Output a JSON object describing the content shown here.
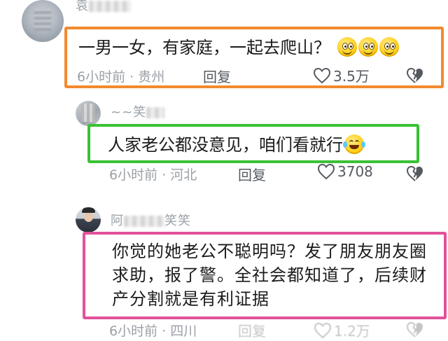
{
  "comments": [
    {
      "username": "袁",
      "text": "一男一女，有家庭，一起去爬山？",
      "emoji_count": 3,
      "time": "6小时前",
      "location": "贵州",
      "reply_label": "回复",
      "likes": "3.5万",
      "highlight_color": "#f28a2e"
    },
    {
      "username": "~~笑",
      "text": "人家老公都没意见，咱们看就行",
      "time": "6小时前",
      "location": "河北",
      "reply_label": "回复",
      "likes": "3708",
      "highlight_color": "#39c234"
    },
    {
      "username": "阿",
      "username_suffix": "笑笑",
      "text": "你觉的她老公不聪明吗？发了朋友朋友圈求助，报了警。全社会都知道了，后续财产分割就是有利证据",
      "time": "6小时前",
      "location": "四川",
      "reply_label": "回复",
      "likes": "1.2万",
      "highlight_color": "#e2519a"
    }
  ],
  "meta_separator": "·",
  "icons": [
    "heart-outline-icon",
    "broken-heart-icon",
    "grin-emoji-icon",
    "laughing-tears-emoji-icon"
  ]
}
